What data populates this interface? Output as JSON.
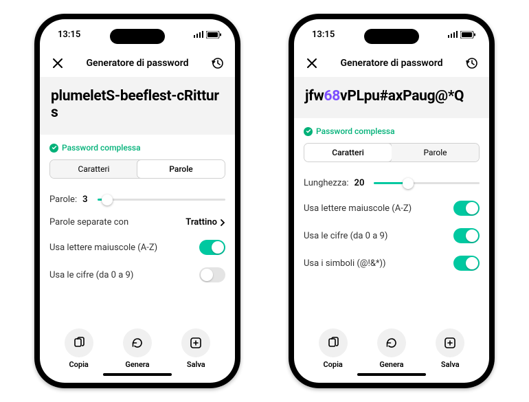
{
  "phones": [
    {
      "status": {
        "time": "13:15"
      },
      "nav": {
        "title": "Generatore di password"
      },
      "password_segments": [
        {
          "text": "plumeletS-beeflest-cRitturs",
          "digit": false
        }
      ],
      "strength_label": "Password complessa",
      "segmented": {
        "left": "Caratteri",
        "right": "Parole",
        "active": "right"
      },
      "rows": {
        "count_label": "Parole:",
        "count_value": "3",
        "separator_label": "Parole separate con",
        "separator_value": "Trattino",
        "uppercase_label": "Usa lettere maiuscole (A-Z)",
        "uppercase_on": true,
        "digits_label": "Usa le cifre (da 0 a 9)",
        "digits_on": false
      },
      "slider_fill_pct": "8%",
      "actions": {
        "copy": "Copia",
        "generate": "Genera",
        "save": "Salva"
      }
    },
    {
      "status": {
        "time": "13:15"
      },
      "nav": {
        "title": "Generatore di password"
      },
      "password_segments": [
        {
          "text": "jfw",
          "digit": false
        },
        {
          "text": "68",
          "digit": true
        },
        {
          "text": "vPLpu#axPaug@*Q",
          "digit": false
        }
      ],
      "strength_label": "Password complessa",
      "segmented": {
        "left": "Caratteri",
        "right": "Parole",
        "active": "left"
      },
      "rows": {
        "length_label": "Lunghezza:",
        "length_value": "20",
        "uppercase_label": "Usa lettere maiuscole (A-Z)",
        "uppercase_on": true,
        "digits_label": "Usa le cifre (da 0 a 9)",
        "digits_on": true,
        "symbols_label": "Usa i simboli (@!&*))",
        "symbols_on": true
      },
      "slider_fill_pct": "32%",
      "actions": {
        "copy": "Copia",
        "generate": "Genera",
        "save": "Salva"
      }
    }
  ]
}
